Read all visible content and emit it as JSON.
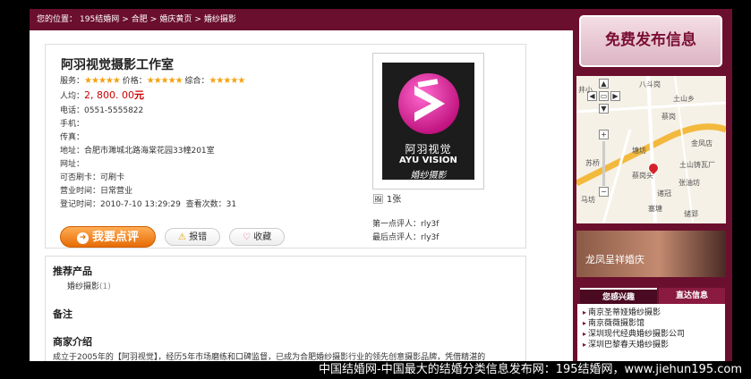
{
  "breadcrumb": {
    "prefix": "您的位置：",
    "items": [
      "195结婚网",
      "合肥",
      "婚庆黄页",
      "婚纱摄影"
    ],
    "separator": ">"
  },
  "studio": {
    "name": "阿羽视觉摄影工作室",
    "service_label": "服务：",
    "price_label": "价格：",
    "overall_label": "综合：",
    "stars": "★★★★★",
    "avg_label": "人均：",
    "avg_value": "2, 800. 00",
    "avg_unit": "元",
    "phone_label": "电话：",
    "phone_value": "0551-5555822",
    "mobile_label": "手机：",
    "fax_label": "传真：",
    "address_label": "地址：",
    "address_value": "合肥市濉城北路海棠花园33幢201室",
    "website_label": "网址：",
    "card_label": "可否刷卡：",
    "card_value": "可刷卡",
    "hours_label": "营业时间：",
    "hours_value": "日常营业",
    "registered_label": "登记时间：",
    "registered_value": "2010-7-10 13:29:29",
    "views_label": "查看次数：",
    "views_value": "31"
  },
  "actions": {
    "review": "我要点评",
    "report": "报错",
    "favorite": "收藏"
  },
  "logo": {
    "brand_cn": "阿羽视觉",
    "brand_en": "AYU VISION",
    "tagline": "婚纱摄影"
  },
  "photos": {
    "count": "1张"
  },
  "reviewers": {
    "first_label": "第一点评人：",
    "first_value": "rly3f",
    "last_label": "最后点评人：",
    "last_value": "rly3f"
  },
  "sections": {
    "products_title": "推荐产品",
    "product_name": "婚纱摄影",
    "product_count": "(1)",
    "notes_title": "备注",
    "intro_title": "商家介绍",
    "intro_text": "成立于2005年的【阿羽视觉】，经历5年市场磨练和口碑监督，已成为合肥婚纱摄影行业的领先创意摄影品牌，凭借精湛的"
  },
  "sidebar": {
    "free_post": "免费发布信息",
    "ad_text": "龙凤呈祥婚庆",
    "tab_interest": "您感兴趣",
    "tab_direct": "直达信息",
    "list": [
      "南京圣蒂娅婚纱摄影",
      "南京薇薇摄影馆",
      "深圳现代经典婚纱摄影公司",
      "深圳巴黎春天婚纱摄影"
    ]
  },
  "map": {
    "labels": [
      "八斗岗",
      "井小",
      "土山乡",
      "蔡岗",
      "金凤店",
      "苏桥",
      "塘坊",
      "土山铸瓦厂",
      "蔡岗头",
      "张油坊",
      "诸冠",
      "塞塘",
      "储郢",
      "马坊"
    ]
  },
  "footer": {
    "text": "中国结婚网-中国最大的结婚分类信息发布网：195结婚网，www.jiehun195.com"
  },
  "colors": {
    "brand": "#6b0f2e",
    "accent_orange": "#e66c06",
    "price_red": "#cc0000",
    "star": "#f3a20e"
  }
}
